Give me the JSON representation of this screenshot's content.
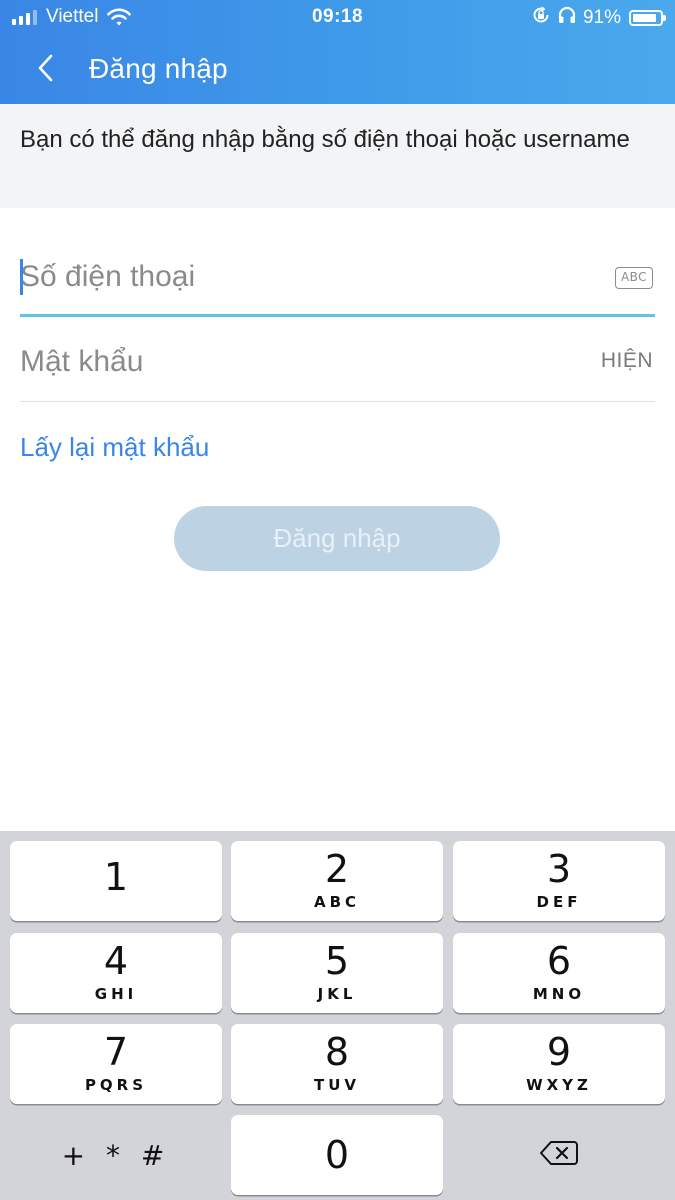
{
  "status_bar": {
    "carrier": "Viettel",
    "time": "09:18",
    "battery_percent": "91%",
    "battery_level": 0.91,
    "icons": [
      "signal-icon",
      "wifi-icon",
      "orientation-lock-icon",
      "headphones-icon",
      "battery-icon"
    ]
  },
  "nav": {
    "back_icon": "chevron-left-icon",
    "title": "Đăng nhập"
  },
  "info": {
    "text": "Bạn có thể đăng nhập bằng số điện thoại hoặc username"
  },
  "form": {
    "phone_placeholder": "Số điện thoại",
    "phone_value": "",
    "abc_badge": "ABC",
    "password_placeholder": "Mật khẩu",
    "password_value": "",
    "show_label": "HIỆN",
    "forgot_label": "Lấy lại mật khẩu",
    "login_label": "Đăng nhập"
  },
  "colors": {
    "header_blue": "#3a86e6",
    "link_blue": "#3a86e6",
    "active_underline": "#62c4e4",
    "disabled_button": "#bdd2e3",
    "keypad_bg": "#d2d4da"
  },
  "keypad": {
    "keys": [
      {
        "digit": "1",
        "letters": ""
      },
      {
        "digit": "2",
        "letters": "ABC"
      },
      {
        "digit": "3",
        "letters": "DEF"
      },
      {
        "digit": "4",
        "letters": "GHI"
      },
      {
        "digit": "5",
        "letters": "JKL"
      },
      {
        "digit": "6",
        "letters": "MNO"
      },
      {
        "digit": "7",
        "letters": "PQRS"
      },
      {
        "digit": "8",
        "letters": "TUV"
      },
      {
        "digit": "9",
        "letters": "WXYZ"
      }
    ],
    "symbols": "+ * #",
    "zero": "0",
    "delete_icon": "backspace-icon"
  }
}
